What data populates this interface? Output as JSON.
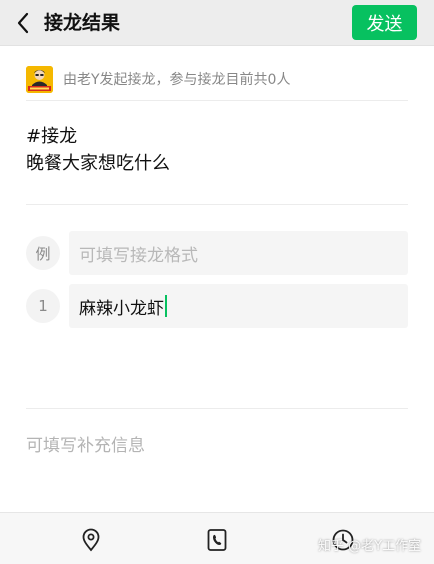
{
  "header": {
    "title": "接龙结果",
    "back_icon": "chevron-left-icon",
    "send_label": "发送"
  },
  "colors": {
    "accent": "#07c160",
    "header_bg": "#ededed",
    "muted_text": "#888888",
    "placeholder": "#b8b8b8"
  },
  "initiator": {
    "text": "由老Y发起接龙，参与接龙目前共0人"
  },
  "topic": {
    "line1": "#接龙",
    "line2": "晚餐大家想吃什么"
  },
  "entries": [
    {
      "number": "例",
      "placeholder": "可填写接龙格式",
      "value": ""
    },
    {
      "number": "1",
      "value": "麻辣小龙虾"
    }
  ],
  "extra": {
    "placeholder": "可填写补充信息"
  },
  "toolbar": {
    "icons": [
      "location-icon",
      "phone-icon",
      "clock-icon"
    ]
  },
  "watermark": {
    "text": "知乎 @老Y工作室"
  }
}
